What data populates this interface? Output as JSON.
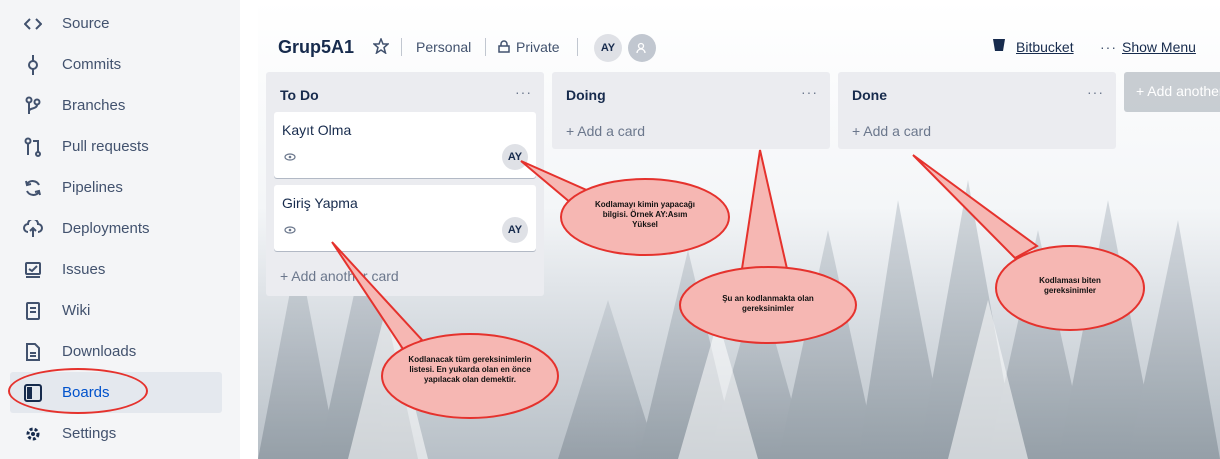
{
  "sidebar": {
    "items": [
      {
        "label": "Source",
        "icon": "code-icon"
      },
      {
        "label": "Commits",
        "icon": "commit-icon"
      },
      {
        "label": "Branches",
        "icon": "branch-icon"
      },
      {
        "label": "Pull requests",
        "icon": "pull-request-icon"
      },
      {
        "label": "Pipelines",
        "icon": "pipelines-icon"
      },
      {
        "label": "Deployments",
        "icon": "deployments-icon"
      },
      {
        "label": "Issues",
        "icon": "issues-icon"
      },
      {
        "label": "Wiki",
        "icon": "wiki-icon"
      },
      {
        "label": "Downloads",
        "icon": "downloads-icon"
      },
      {
        "label": "Boards",
        "icon": "boards-icon",
        "active": true
      },
      {
        "label": "Settings",
        "icon": "gear-icon"
      }
    ]
  },
  "header": {
    "board_name": "Grup5A1",
    "team": "Personal",
    "visibility": "Private",
    "avatar_initials": "AY",
    "bitbucket_label": "Bitbucket",
    "menu_dots": "···",
    "show_menu_label": "Show Menu"
  },
  "lists": [
    {
      "title": "To Do",
      "menu": "···",
      "cards": [
        {
          "title": "Kayıt Olma",
          "assignee": "AY"
        },
        {
          "title": "Giriş Yapma",
          "assignee": "AY"
        }
      ],
      "add_label": "+ Add another card"
    },
    {
      "title": "Doing",
      "menu": "···",
      "cards": [],
      "add_label": "+ Add a card"
    },
    {
      "title": "Done",
      "menu": "···",
      "cards": [],
      "add_label": "+ Add a card"
    }
  ],
  "add_list_label": "+ Add another list",
  "callouts": {
    "assignee": "Kodlamayı kimin yapacağı bilgisi. Örnek AY:Asım Yüksel",
    "todo": "Kodlanacak tüm gereksinimlerin listesi. En yukarda olan en önce yapılacak olan demektir.",
    "doing": "Şu an kodlanmakta olan gereksinimler",
    "done": "Kodlaması biten gereksinimler"
  },
  "colors": {
    "callout_fill": "#f6b7b3",
    "callout_stroke": "#e5322d",
    "active_nav": "#0052cc",
    "list_bg": "#ebecf0"
  }
}
